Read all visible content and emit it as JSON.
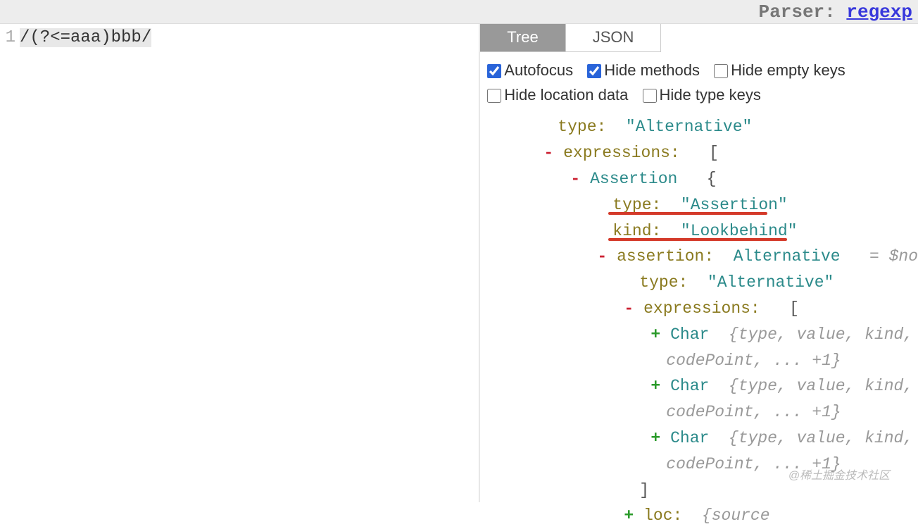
{
  "header": {
    "parser_label": "Parser:",
    "parser_name": "regexp"
  },
  "editor": {
    "line_number": "1",
    "code": "/(?<=aaa)bbb/"
  },
  "tabs": {
    "tree": "Tree",
    "json": "JSON"
  },
  "options": {
    "autofocus": "Autofocus",
    "hide_methods": "Hide methods",
    "hide_empty_keys": "Hide empty keys",
    "hide_location_data": "Hide location data",
    "hide_type_keys": "Hide type keys"
  },
  "tree": {
    "type_key": "type:",
    "alternative": "\"Alternative\"",
    "expressions_key": "expressions:",
    "assertion_name": "Assertion",
    "assertion_type_val": "\"Assertion\"",
    "kind_key": "kind:",
    "kind_val": "\"Lookbehind\"",
    "assertion_key": "assertion:",
    "alternative_name": "Alternative",
    "node_meta": "= $no",
    "char_name": "Char",
    "char_meta1": "{type, value, kind,",
    "char_meta2": "codePoint, ... +1}",
    "loc_key": "loc:",
    "loc_meta": "{source",
    "brace_open": "{",
    "brace_close": "}",
    "bracket_open": "[",
    "bracket_close": "]"
  },
  "watermark": "@稀土掘金技术社区"
}
